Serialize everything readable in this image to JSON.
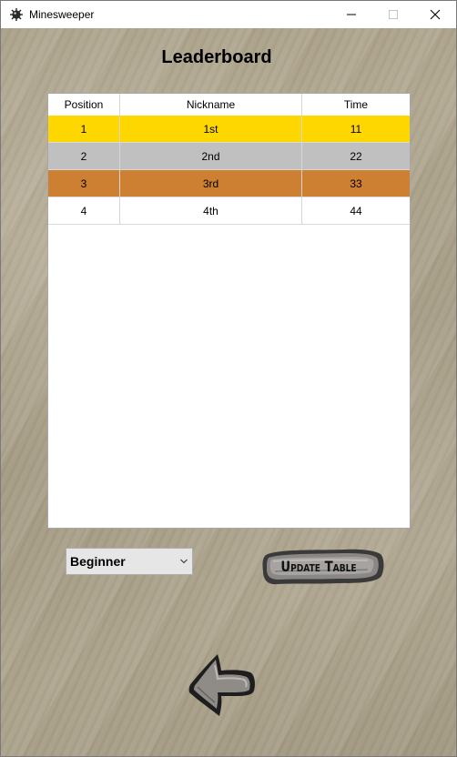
{
  "window": {
    "title": "Minesweeper"
  },
  "heading": "Leaderboard",
  "table": {
    "headers": [
      "Position",
      "Nickname",
      "Time"
    ],
    "rows": [
      {
        "position": "1",
        "nickname": "1st",
        "time": "11",
        "highlight": "#ffd700"
      },
      {
        "position": "2",
        "nickname": "2nd",
        "time": "22",
        "highlight": "#c0c0c0"
      },
      {
        "position": "3",
        "nickname": "3rd",
        "time": "33",
        "highlight": "#cd7f32"
      },
      {
        "position": "4",
        "nickname": "4th",
        "time": "44",
        "highlight": "#ffffff"
      }
    ]
  },
  "difficulty": {
    "selected": "Beginner"
  },
  "buttons": {
    "update": "Update Table"
  },
  "icons": {
    "app": "mine-icon",
    "back": "back-arrow-icon",
    "dropdown": "chevron-down-icon"
  }
}
